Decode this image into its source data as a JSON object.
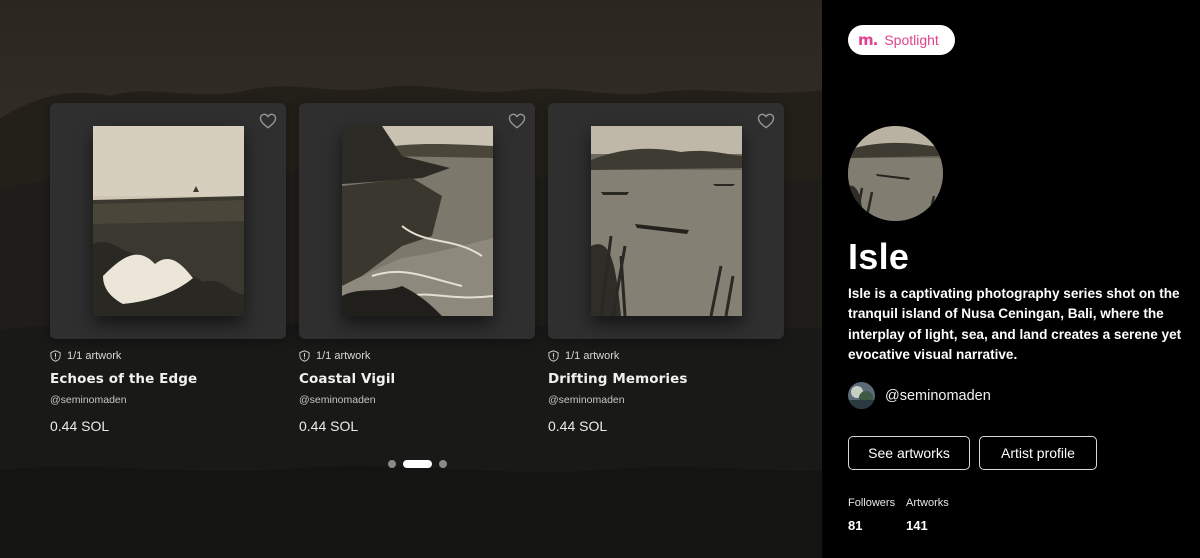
{
  "carousel": {
    "cards": [
      {
        "edition": "1/1 artwork",
        "title": "Echoes of the Edge",
        "artist": "@seminomaden",
        "price": "0.44 SOL"
      },
      {
        "edition": "1/1 artwork",
        "title": "Coastal Vigil",
        "artist": "@seminomaden",
        "price": "0.44 SOL"
      },
      {
        "edition": "1/1 artwork",
        "title": "Drifting Memories",
        "artist": "@seminomaden",
        "price": "0.44 SOL"
      }
    ],
    "active_page": 2,
    "page_count": 3
  },
  "spotlight": {
    "badge_logo": "m.",
    "badge_label": "Spotlight",
    "title": "Isle",
    "description": "Isle is a captivating photography series shot on the tranquil island of Nusa Ceningan, Bali, where the interplay of light, sea, and land creates a serene yet evocative visual narrative.",
    "artist_handle": "@seminomaden",
    "see_artworks_label": "See artworks",
    "artist_profile_label": "Artist profile",
    "followers_label": "Followers",
    "followers_value": "81",
    "artworks_label": "Artworks",
    "artworks_value": "141"
  },
  "colors": {
    "accent_pink": "#e0428d",
    "panel_bg": "#000000",
    "card_bg": "#2f2f2f"
  }
}
